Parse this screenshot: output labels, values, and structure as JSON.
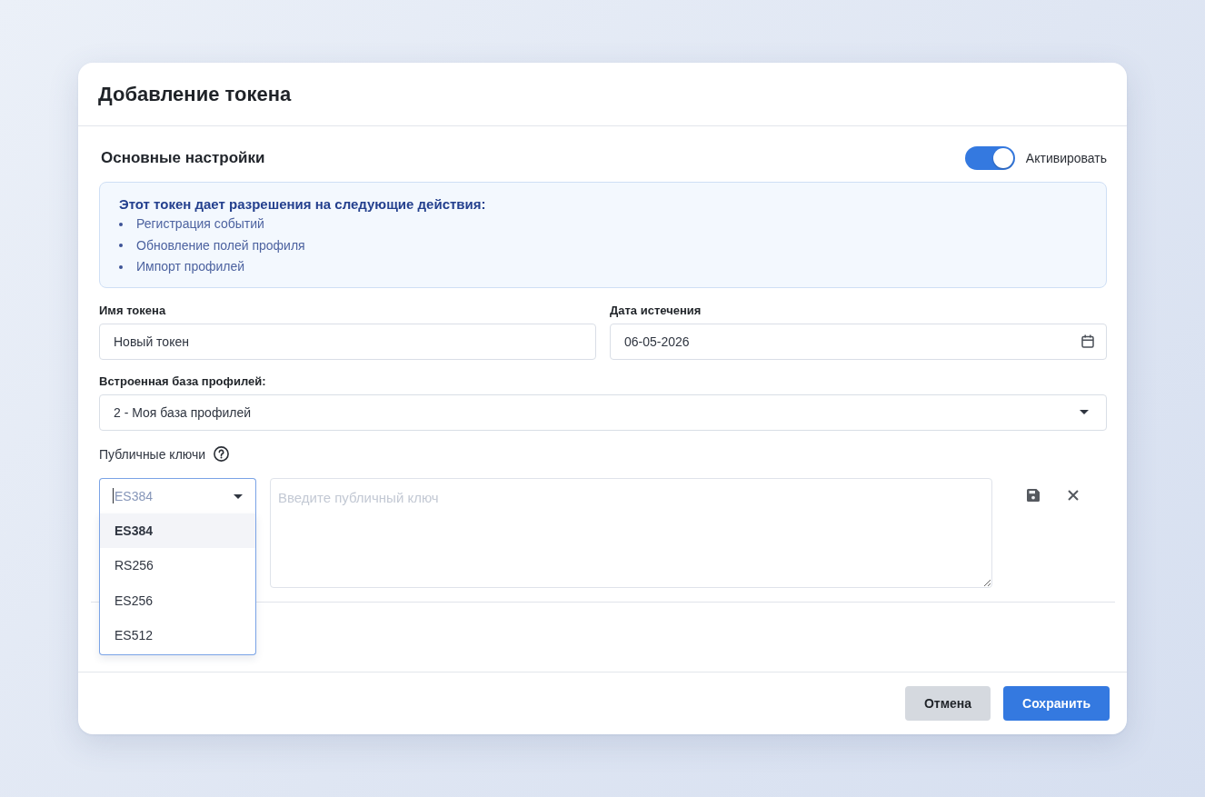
{
  "dialog": {
    "title": "Добавление токена"
  },
  "section": {
    "title": "Основные настройки",
    "toggle": {
      "label": "Активировать",
      "on": true
    }
  },
  "info": {
    "title": "Этот токен дает разрешения на следующие действия:",
    "items": [
      "Регистрация событий",
      "Обновление полей профиля",
      "Импорт профилей"
    ]
  },
  "fields": [
    {
      "kind": "text",
      "label": "Имя токена",
      "value": "Новый токен"
    },
    {
      "kind": "date",
      "label": "Дата истечения",
      "value": "06-05-2026"
    },
    {
      "kind": "select",
      "label": "Встроенная база профилей:",
      "value": "2 - Моя база профилей"
    }
  ],
  "public_keys": {
    "label": "Публичные ключи",
    "algorithm": {
      "placeholder": "ES384",
      "expanded": true,
      "options": [
        {
          "label": "ES384",
          "selected": true
        },
        {
          "label": "RS256",
          "selected": false
        },
        {
          "label": "ES256",
          "selected": false
        },
        {
          "label": "ES512",
          "selected": false
        }
      ]
    },
    "key_field": {
      "placeholder": "Введите публичный ключ"
    }
  },
  "buttons": [
    {
      "kind": "secondary",
      "label": "Отмена"
    },
    {
      "kind": "primary",
      "label": "Сохранить"
    }
  ]
}
